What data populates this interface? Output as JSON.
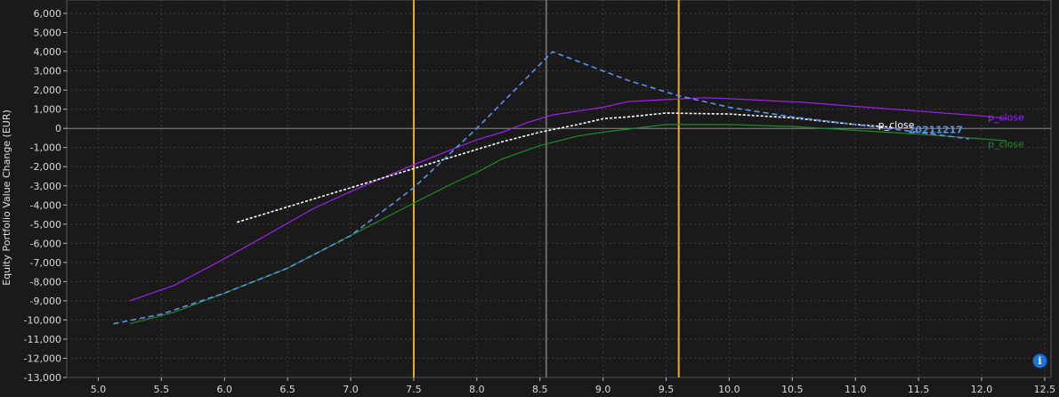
{
  "chart_data": {
    "type": "line",
    "title": "",
    "xlabel": "",
    "ylabel": "Equity Portfolio Value Change (EUR)",
    "xlim": [
      4.75,
      12.55
    ],
    "ylim": [
      -13000,
      6700
    ],
    "x_ticks": [
      5.0,
      5.5,
      6.0,
      6.5,
      7.0,
      7.5,
      8.0,
      8.5,
      9.0,
      9.5,
      10.0,
      10.5,
      11.0,
      11.5,
      12.0,
      12.5
    ],
    "y_ticks": [
      6000,
      5000,
      4000,
      3000,
      2000,
      1000,
      0,
      -1000,
      -2000,
      -3000,
      -4000,
      -5000,
      -6000,
      -7000,
      -8000,
      -9000,
      -10000,
      -11000,
      -12000,
      -13000
    ],
    "x_tick_labels": [
      "5.0",
      "5.5",
      "6.0",
      "6.5",
      "7.0",
      "7.5",
      "8.0",
      "8.5",
      "9.0",
      "9.5",
      "10.0",
      "10.5",
      "11.0",
      "11.5",
      "12.0",
      "12.5"
    ],
    "y_tick_labels": [
      "6,000",
      "5,000",
      "4,000",
      "3,000",
      "2,000",
      "1,000",
      "0",
      "-1,000",
      "-2,000",
      "-3,000",
      "-4,000",
      "-5,000",
      "-6,000",
      "-7,000",
      "-8,000",
      "-9,000",
      "-10,000",
      "-11,000",
      "-12,000",
      "-13,000"
    ],
    "grid": true,
    "vertical_lines": [
      {
        "x": 7.5,
        "color": "#e8b020"
      },
      {
        "x": 8.55,
        "color": "#6a6a6a"
      },
      {
        "x": 9.6,
        "color": "#e8b020"
      }
    ],
    "series": [
      {
        "name": "p_close",
        "color": "#a020f0",
        "style": "solid",
        "x": [
          5.25,
          5.6,
          6.0,
          6.3,
          6.7,
          7.0,
          7.5,
          7.8,
          8.0,
          8.2,
          8.4,
          8.6,
          8.8,
          9.0,
          9.2,
          9.5,
          9.8,
          10.0,
          10.3,
          10.6,
          11.0,
          11.5,
          12.0,
          12.2
        ],
        "y": [
          -9000,
          -8200,
          -6800,
          -5700,
          -4200,
          -3300,
          -1900,
          -1100,
          -600,
          -200,
          300,
          700,
          900,
          1100,
          1400,
          1500,
          1600,
          1550,
          1450,
          1350,
          1150,
          900,
          650,
          500
        ]
      },
      {
        "name": "p_close",
        "color": "#1f8a2a",
        "style": "solid",
        "x": [
          5.25,
          5.6,
          6.0,
          6.5,
          7.0,
          7.5,
          7.8,
          8.0,
          8.2,
          8.5,
          8.8,
          9.0,
          9.5,
          10.0,
          10.5,
          11.0,
          11.5,
          12.0,
          12.2
        ],
        "y": [
          -10200,
          -9600,
          -8600,
          -7300,
          -5600,
          -3900,
          -2900,
          -2300,
          -1600,
          -900,
          -400,
          -200,
          200,
          200,
          100,
          -100,
          -300,
          -550,
          -650
        ]
      },
      {
        "name": "p_close",
        "color": "#ffffff",
        "style": "dashed",
        "x": [
          6.1,
          6.5,
          7.0,
          7.5,
          7.8,
          8.0,
          8.2,
          8.5,
          8.8,
          9.0,
          9.2,
          9.5,
          10.0,
          10.5,
          11.0,
          11.3
        ],
        "y": [
          -4900,
          -4100,
          -3100,
          -2100,
          -1500,
          -1100,
          -700,
          -200,
          200,
          500,
          600,
          800,
          750,
          550,
          200,
          50
        ]
      },
      {
        "name": "20211217",
        "color": "#5b93e8",
        "style": "dashed",
        "x": [
          5.12,
          5.5,
          6.0,
          6.5,
          7.0,
          7.5,
          8.0,
          8.6,
          9.2,
          9.6,
          10.0,
          10.5,
          11.0,
          11.5,
          11.9
        ],
        "y": [
          -10200,
          -9700,
          -8600,
          -7300,
          -5600,
          -3100,
          0,
          4000,
          2500,
          1700,
          1100,
          600,
          200,
          -200,
          -550
        ]
      }
    ],
    "labels": [
      {
        "text": "p_close",
        "series_index": 0,
        "x": 12.05,
        "y": 400,
        "color": "#a020f0"
      },
      {
        "text": "p_close",
        "series_index": 1,
        "x": 12.05,
        "y": -1000,
        "color": "#1f8a2a"
      },
      {
        "text": "p_close",
        "series_index": 2,
        "x": 11.18,
        "y": 0,
        "color": "#ffffff"
      },
      {
        "text": "20211217",
        "series_index": 3,
        "x": 11.42,
        "y": -250,
        "color": "#5b93e8"
      }
    ]
  },
  "info_button": {
    "label": "i",
    "icon": "info-icon"
  }
}
